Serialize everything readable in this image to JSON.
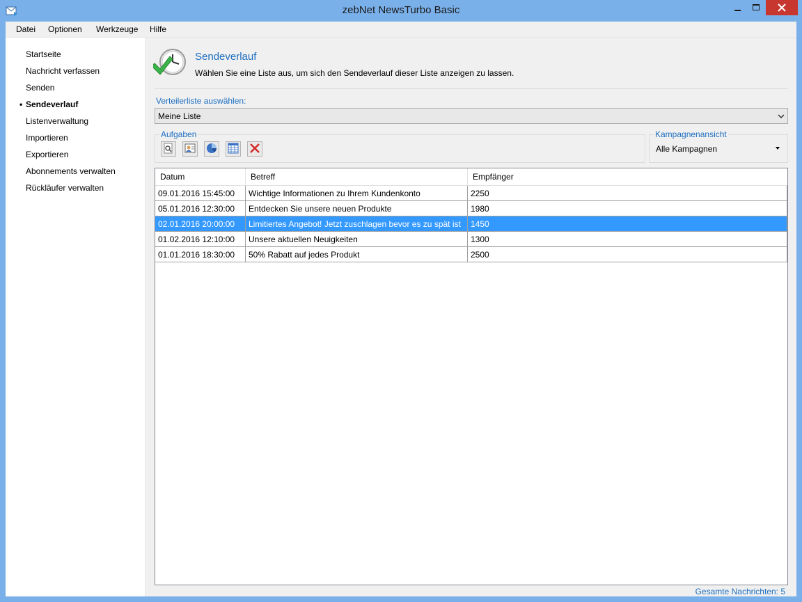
{
  "window": {
    "title": "zebNet NewsTurbo Basic"
  },
  "menu": [
    {
      "label": "Datei"
    },
    {
      "label": "Optionen"
    },
    {
      "label": "Werkzeuge"
    },
    {
      "label": "Hilfe"
    }
  ],
  "sidebar": {
    "items": [
      {
        "label": "Startseite",
        "active": false
      },
      {
        "label": "Nachricht verfassen",
        "active": false
      },
      {
        "label": "Senden",
        "active": false
      },
      {
        "label": "Sendeverlauf",
        "active": true
      },
      {
        "label": "Listenverwaltung",
        "active": false
      },
      {
        "label": "Importieren",
        "active": false
      },
      {
        "label": "Exportieren",
        "active": false
      },
      {
        "label": "Abonnements verwalten",
        "active": false
      },
      {
        "label": "Rückläufer verwalten",
        "active": false
      }
    ],
    "bullet": "•"
  },
  "header": {
    "title": "Sendeverlauf",
    "description": "Wählen Sie eine Liste aus, um sich den Sendeverlauf dieser Liste anzeigen zu lassen."
  },
  "list_select": {
    "label": "Verteilerliste auswählen:",
    "value": "Meine Liste"
  },
  "tasks": {
    "legend": "Aufgaben",
    "buttons": [
      {
        "icon": "preview-icon"
      },
      {
        "icon": "recipients-icon"
      },
      {
        "icon": "pie-chart-icon"
      },
      {
        "icon": "table-icon"
      },
      {
        "icon": "delete-icon"
      }
    ]
  },
  "campaigns": {
    "legend": "Kampagnenansicht",
    "value": "Alle Kampagnen"
  },
  "grid": {
    "columns": [
      "Datum",
      "Betreff",
      "Empfänger"
    ],
    "rows": [
      {
        "date": "09.01.2016 15:45:00",
        "subject": "Wichtige Informationen zu Ihrem Kundenkonto",
        "recipients": "2250",
        "selected": false
      },
      {
        "date": "05.01.2016 12:30:00",
        "subject": "Entdecken Sie unsere neuen Produkte",
        "recipients": "1980",
        "selected": false
      },
      {
        "date": "02.01.2016 20:00:00",
        "subject": "Limitiertes Angebot! Jetzt zuschlagen bevor es zu spät ist",
        "recipients": "1450",
        "selected": true
      },
      {
        "date": "01.02.2016 12:10:00",
        "subject": "Unsere aktuellen Neuigkeiten",
        "recipients": "1300",
        "selected": false
      },
      {
        "date": "01.01.2016 18:30:00",
        "subject": "50% Rabatt auf jedes Produkt",
        "recipients": "2500",
        "selected": false
      }
    ]
  },
  "status": {
    "total": "Gesamte Nachrichten: 5"
  },
  "colors": {
    "accent": "#1e6fc0",
    "selection": "#3399ff",
    "titlebar": "#7ab0ea",
    "close": "#c7372f"
  }
}
